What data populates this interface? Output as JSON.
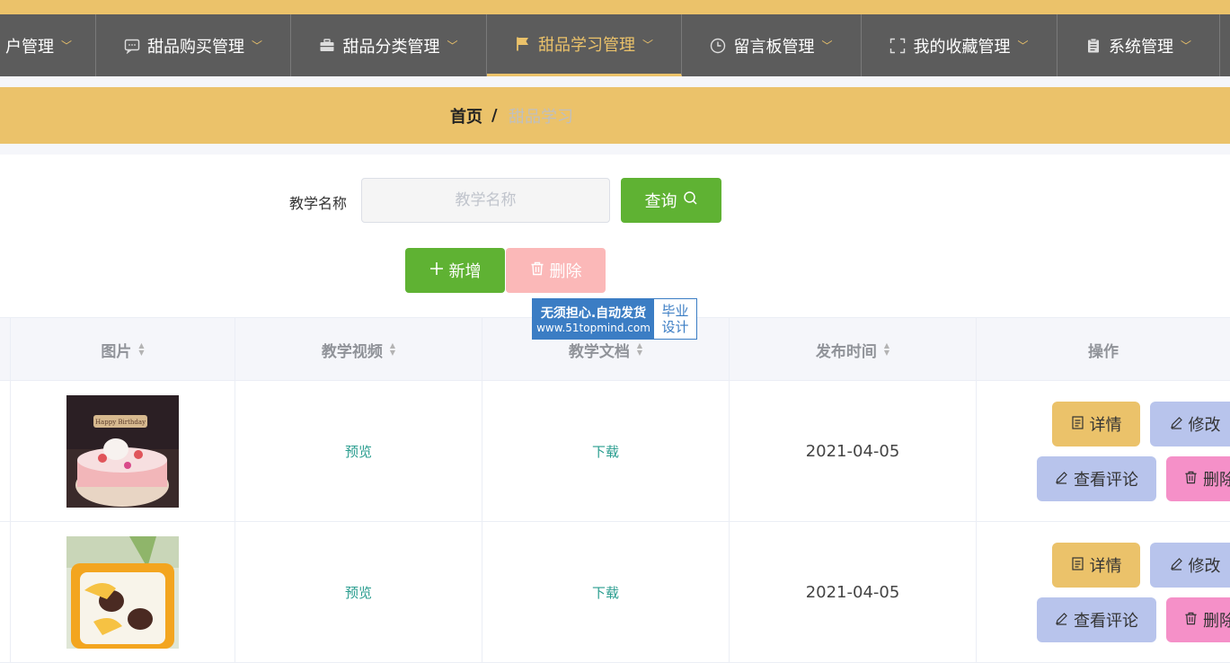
{
  "nav": {
    "items": [
      {
        "label": "户管理",
        "icon": "user-icon"
      },
      {
        "label": "甜品购买管理",
        "icon": "chat-icon"
      },
      {
        "label": "甜品分类管理",
        "icon": "briefcase-icon"
      },
      {
        "label": "甜品学习管理",
        "icon": "flag-icon",
        "active": true
      },
      {
        "label": "留言板管理",
        "icon": "clock-icon"
      },
      {
        "label": "我的收藏管理",
        "icon": "fullscreen-icon"
      },
      {
        "label": "系统管理",
        "icon": "clipboard-icon"
      }
    ]
  },
  "breadcrumb": {
    "home": "首页",
    "separator": "/",
    "current": "甜品学习"
  },
  "search": {
    "label": "教学名称",
    "placeholder": "教学名称",
    "value": "",
    "query_label": "查询"
  },
  "actions": {
    "add_label": "新增",
    "delete_label": "删除"
  },
  "watermark": {
    "line1": "无须担心.自动发货",
    "line2": "www.51topmind.com",
    "right1": "毕业",
    "right2": "设计"
  },
  "table": {
    "headers": [
      "图片",
      "教学视频",
      "教学文档",
      "发布时间",
      "操作"
    ],
    "rows": [
      {
        "video": "预览",
        "doc": "下载",
        "date": "2021-04-05"
      },
      {
        "video": "预览",
        "doc": "下载",
        "date": "2021-04-05"
      }
    ],
    "ops": {
      "detail": "详情",
      "edit": "修改",
      "comment": "查看评论",
      "delete": "删除"
    }
  },
  "colors": {
    "accent": "#ebc26a",
    "nav_bg": "#5c5c5c",
    "primary_green": "#5fb233",
    "link": "#2a9d8f"
  }
}
